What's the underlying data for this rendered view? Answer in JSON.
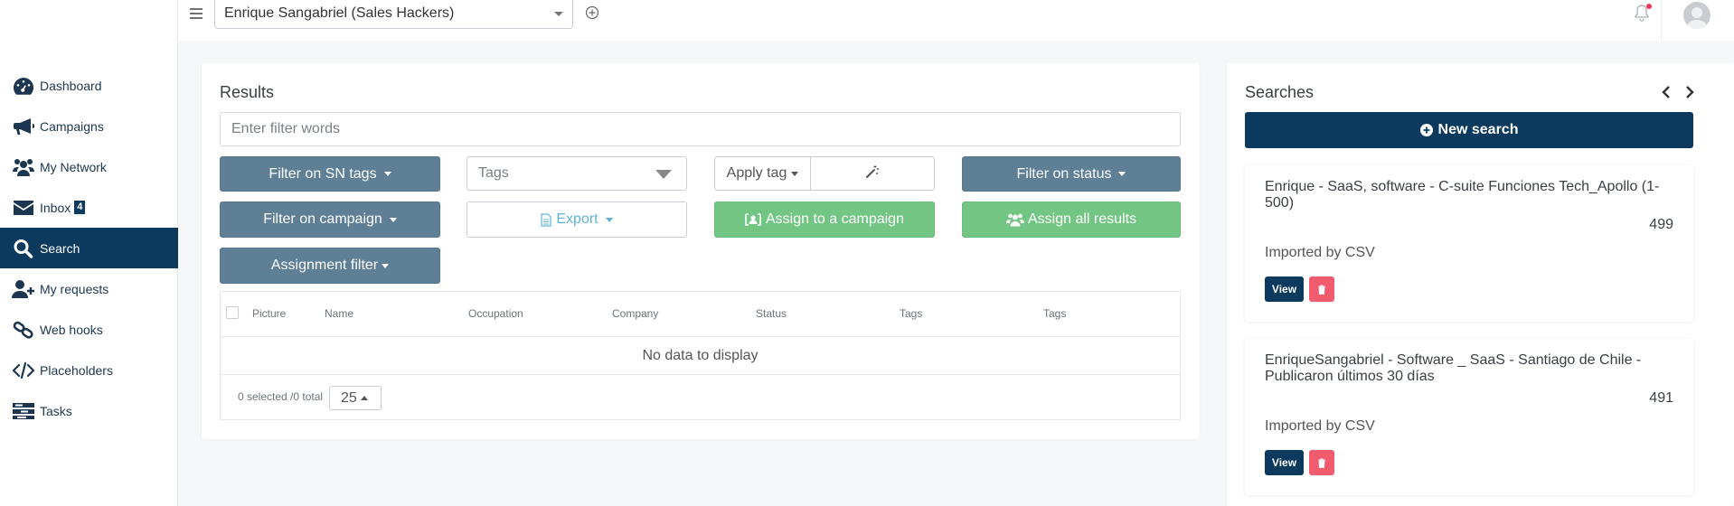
{
  "header": {
    "account": "Enrique Sangabriel (Sales Hackers)"
  },
  "sidebar": {
    "items": [
      {
        "label": "Dashboard",
        "icon": "dashboard-icon"
      },
      {
        "label": "Campaigns",
        "icon": "megaphone-icon"
      },
      {
        "label": "My Network",
        "icon": "users-icon"
      },
      {
        "label": "Inbox",
        "icon": "envelope-icon",
        "badge": "4"
      },
      {
        "label": "Search",
        "icon": "search-icon",
        "active": true
      },
      {
        "label": "My requests",
        "icon": "user-plus-icon"
      },
      {
        "label": "Web hooks",
        "icon": "link-icon"
      },
      {
        "label": "Placeholders",
        "icon": "code-icon"
      },
      {
        "label": "Tasks",
        "icon": "tasks-icon"
      }
    ]
  },
  "results": {
    "title": "Results",
    "filter_placeholder": "Enter filter words",
    "filter_sn_tags": "Filter on SN tags",
    "tags_placeholder": "Tags",
    "apply_tag": "Apply tag",
    "filter_status": "Filter on status",
    "filter_campaign": "Filter on campaign",
    "export": "Export",
    "assign_campaign": "Assign to a campaign",
    "assign_all": "Assign all results",
    "assignment_filter": "Assignment filter",
    "columns": [
      "Picture",
      "Name",
      "Occupation",
      "Company",
      "Status",
      "Tags",
      "Tags"
    ],
    "no_data": "No data to display",
    "selected_count": "0 selected /0 total",
    "page_size": "25"
  },
  "searches": {
    "title": "Searches",
    "new_search": "New search",
    "items": [
      {
        "title": "Enrique - SaaS, software - C-suite Funciones Tech_Apollo (1-500)",
        "count": "499",
        "source": "Imported by CSV",
        "view": "View"
      },
      {
        "title": "EnriqueSangabriel - Software _ SaaS - Santiago de Chile - Publicaron últimos 30 días",
        "count": "491",
        "source": "Imported by CSV",
        "view": "View"
      }
    ]
  },
  "colors": {
    "primary": "#0b3a5e",
    "slate": "#5e7f96",
    "green": "#72c583",
    "danger": "#f15b6e",
    "export_text": "#5fb4d6"
  }
}
